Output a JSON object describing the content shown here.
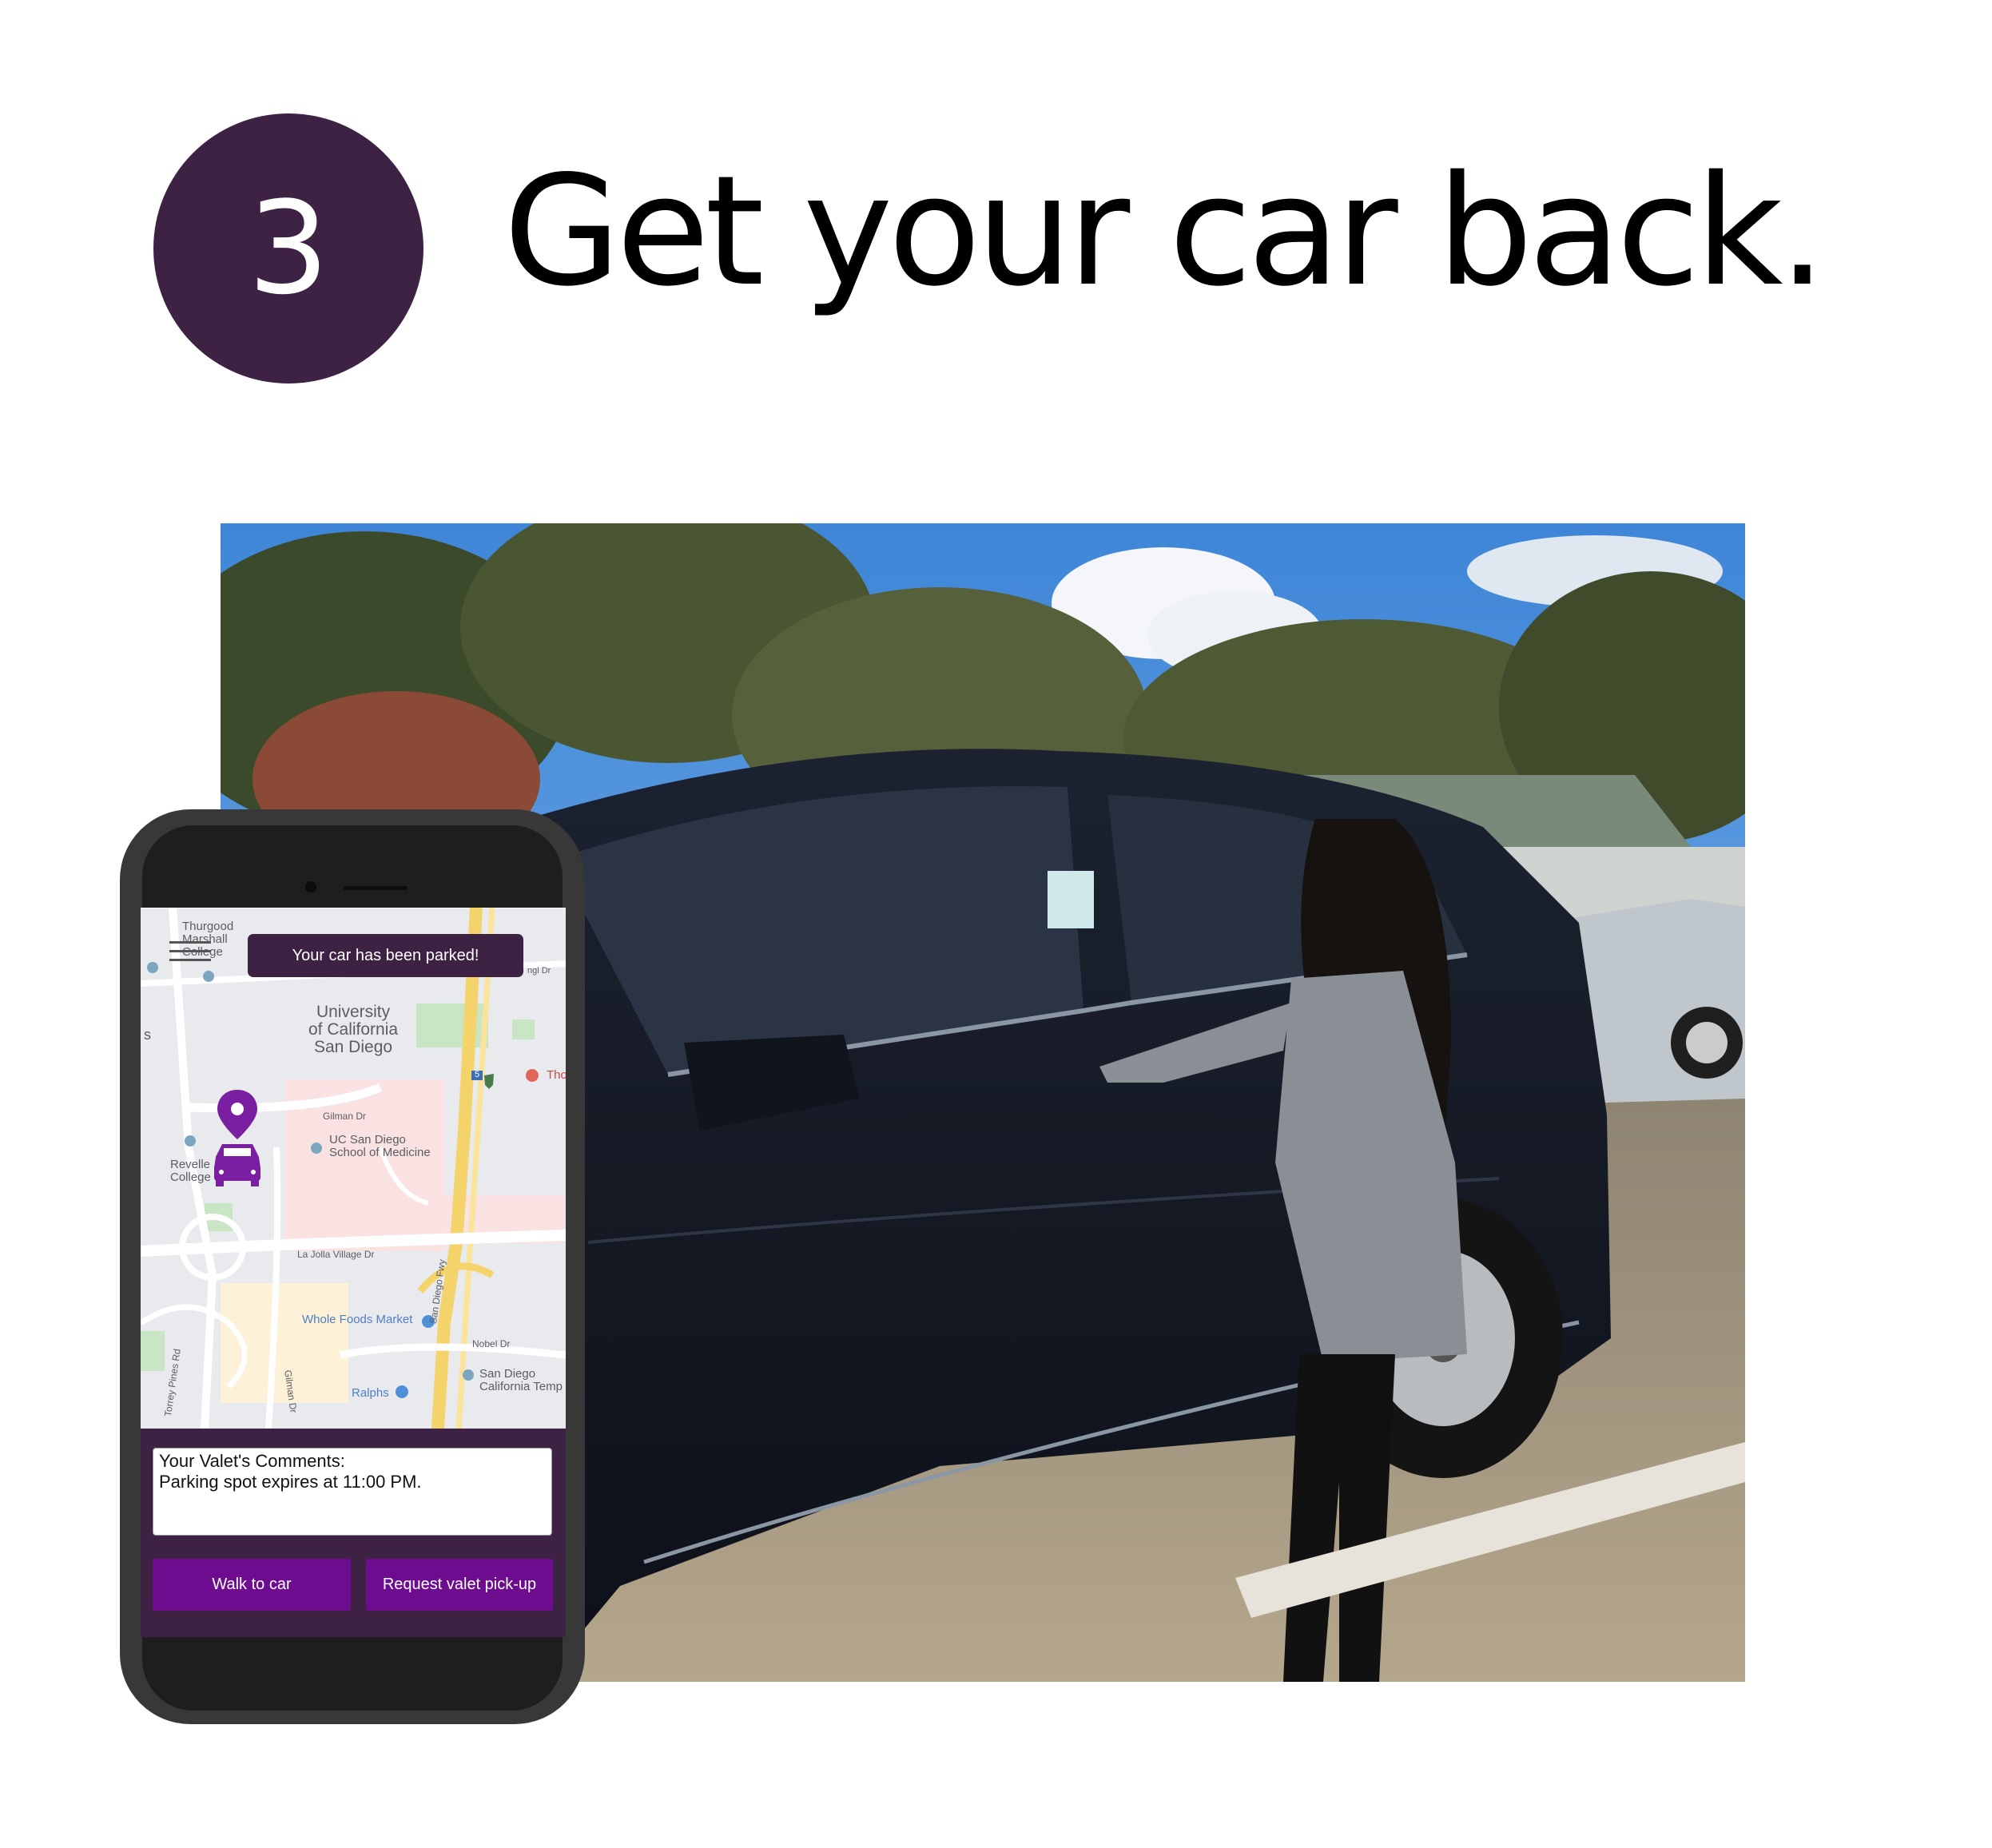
{
  "step": {
    "number": "3",
    "title": "Get your car back."
  },
  "phone": {
    "banner": "Your car has been parked!",
    "map_labels": {
      "marshall": "Thurgood\nMarshall\nCollege",
      "ucsd": "University\nof California\nSan Diego",
      "gilman_dr": "Gilman Dr",
      "med_school": "UC San Diego\nSchool of Medicine",
      "revelle": "Revelle\nCollege",
      "la_jolla_village": "La Jolla Village Dr",
      "whole_foods": "Whole Foods Market",
      "sd_fwy": "San Diego Fwy",
      "nobel": "Nobel Dr",
      "torrey": "Torrey Pines Rd",
      "gilman_dr2": "Gilman Dr",
      "ralphs": "Ralphs",
      "temple": "San Diego\nCalifornia Temp",
      "tho": "Tho",
      "s": "s",
      "ngl": "ngl Dr",
      "i5": "5"
    },
    "comments": {
      "heading": "Your Valet's Comments:",
      "text": "Parking spot expires at 11:00 PM."
    },
    "buttons": {
      "walk": "Walk to car",
      "valet": "Request valet pick-up"
    }
  },
  "colors": {
    "brand_purple": "#3e2244",
    "button_purple": "#6d0c8e"
  },
  "icons": {
    "menu": "hamburger-menu-icon",
    "car_pin": "car-location-pin-icon"
  }
}
